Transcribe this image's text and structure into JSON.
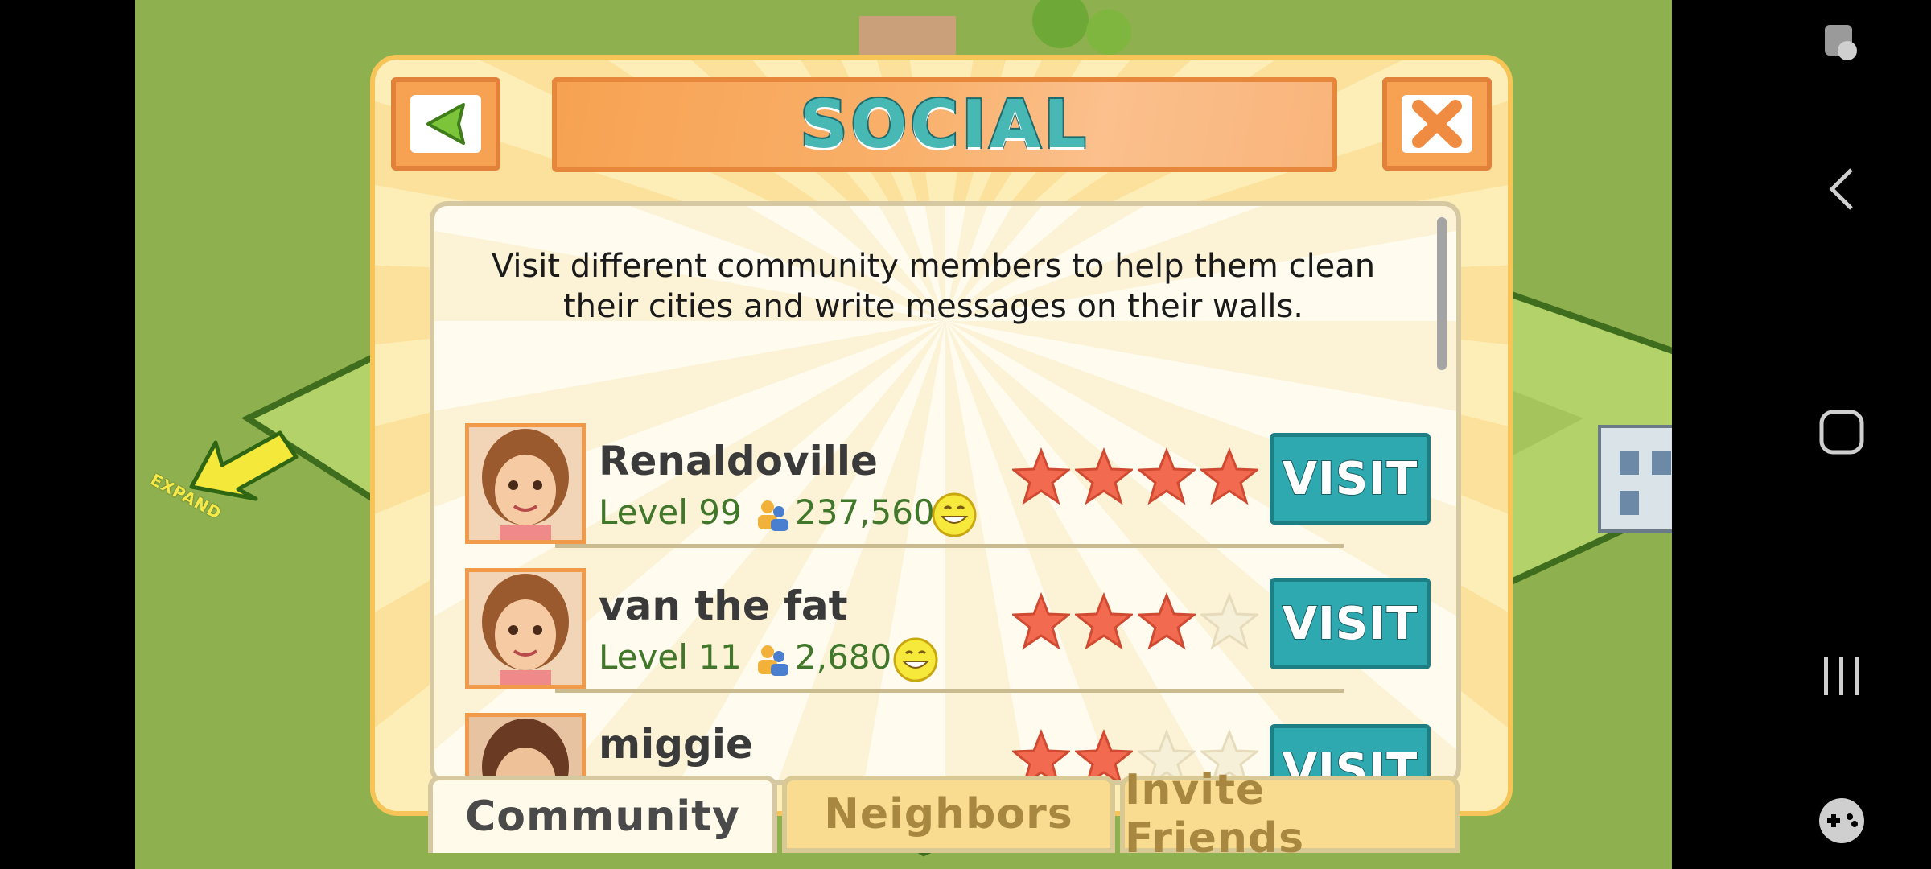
{
  "game": {
    "expand_label": "EXPAND"
  },
  "dialog": {
    "title": "SOCIAL",
    "intro": "Visit different community members to help them clean their cities and write messages on their walls.",
    "members": [
      {
        "name": "Renaldoville",
        "level": "Level 99",
        "population": "237,560",
        "stars": 4,
        "visit_label": "VISIT"
      },
      {
        "name": "van the fat",
        "level": "Level 11",
        "population": "2,680",
        "stars": 3,
        "visit_label": "VISIT"
      },
      {
        "name": "miggie",
        "level": "",
        "population": "",
        "stars": 2,
        "visit_label": "VISIT"
      }
    ],
    "tabs": [
      {
        "label": "Community",
        "active": true
      },
      {
        "label": "Neighbors",
        "active": false
      },
      {
        "label": "Invite Friends",
        "active": false
      }
    ]
  },
  "colors": {
    "accent_teal": "#2ea9b0",
    "title_orange": "#f7a252",
    "star_filled": "#f26a4f",
    "star_empty": "#f6f0d8"
  }
}
